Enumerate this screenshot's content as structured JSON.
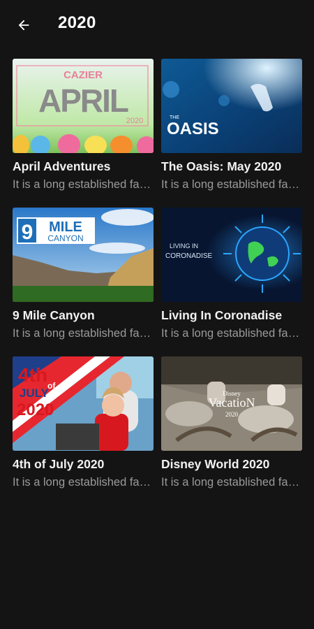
{
  "header": {
    "title": "2020",
    "back_icon": "arrow-left-icon"
  },
  "cards": [
    {
      "title": "April Adventures",
      "subtitle": "It is a long established fact that a reader",
      "thumb_text_1": "CAZIER",
      "thumb_text_2": "APRIL",
      "thumb_text_3": "2020"
    },
    {
      "title": "The Oasis: May 2020",
      "subtitle": "It is a long established fact that a reader",
      "thumb_text_1": "THE",
      "thumb_text_2": "OASIS"
    },
    {
      "title": "9 Mile Canyon",
      "subtitle": "It is a long established fact that a reader",
      "thumb_text_1": "9",
      "thumb_text_2": "MILE",
      "thumb_text_3": "CANYON"
    },
    {
      "title": "Living In Coronadise",
      "subtitle": "It is a long established fact that a reader",
      "thumb_text_1": "LIVING IN",
      "thumb_text_2": "CORONADISE"
    },
    {
      "title": "4th of July 2020",
      "subtitle": "It is a long established fact that a reader",
      "thumb_text_1": "4th",
      "thumb_text_2": "of",
      "thumb_text_3": "JULY",
      "thumb_text_4": "2020"
    },
    {
      "title": "Disney World 2020",
      "subtitle": "It is a long established fact that a reader",
      "thumb_text_1": "Disney",
      "thumb_text_2": "VacatioN",
      "thumb_text_3": "2020"
    }
  ]
}
